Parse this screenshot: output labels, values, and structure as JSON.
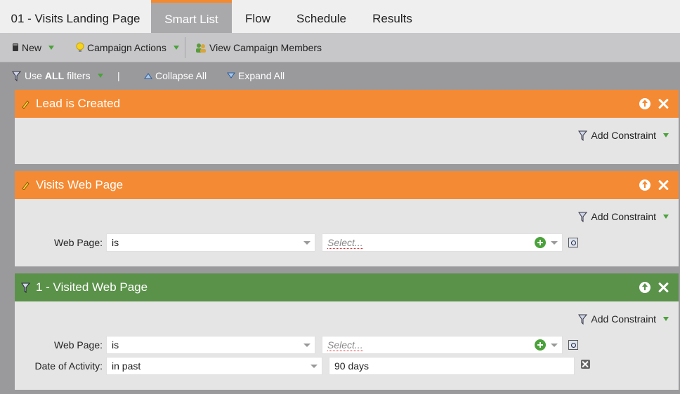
{
  "tabs": [
    {
      "label": "01 - Visits Landing Page",
      "active": false
    },
    {
      "label": "Smart List",
      "active": true
    },
    {
      "label": "Flow",
      "active": false
    },
    {
      "label": "Schedule",
      "active": false
    },
    {
      "label": "Results",
      "active": false
    }
  ],
  "toolbar": {
    "new_label": "New",
    "campaign_actions_label": "Campaign Actions",
    "view_members_label": "View Campaign Members"
  },
  "filterbar": {
    "use_prefix": "Use",
    "use_all": "ALL",
    "use_suffix": "filters",
    "separator": "|",
    "collapse_label": "Collapse All",
    "expand_label": "Expand All"
  },
  "filters": [
    {
      "title": "Lead is Created",
      "color": "#f48a33",
      "add_constraint": "Add Constraint"
    },
    {
      "title": "Visits Web Page",
      "color": "#f48a33",
      "add_constraint": "Add Constraint",
      "rows": [
        {
          "label": "Web Page:",
          "operator": "is",
          "value_placeholder": "Select..."
        }
      ]
    },
    {
      "title": "1 - Visited Web Page",
      "color": "#5b924a",
      "add_constraint": "Add Constraint",
      "rows": [
        {
          "label": "Web Page:",
          "operator": "is",
          "value_placeholder": "Select..."
        },
        {
          "label": "Date of Activity:",
          "operator": "in past",
          "value": "90 days"
        }
      ]
    }
  ],
  "colors": {
    "accent_orange": "#f48a33",
    "trigger_green": "#5b924a",
    "caret_green": "#4aa23a"
  }
}
